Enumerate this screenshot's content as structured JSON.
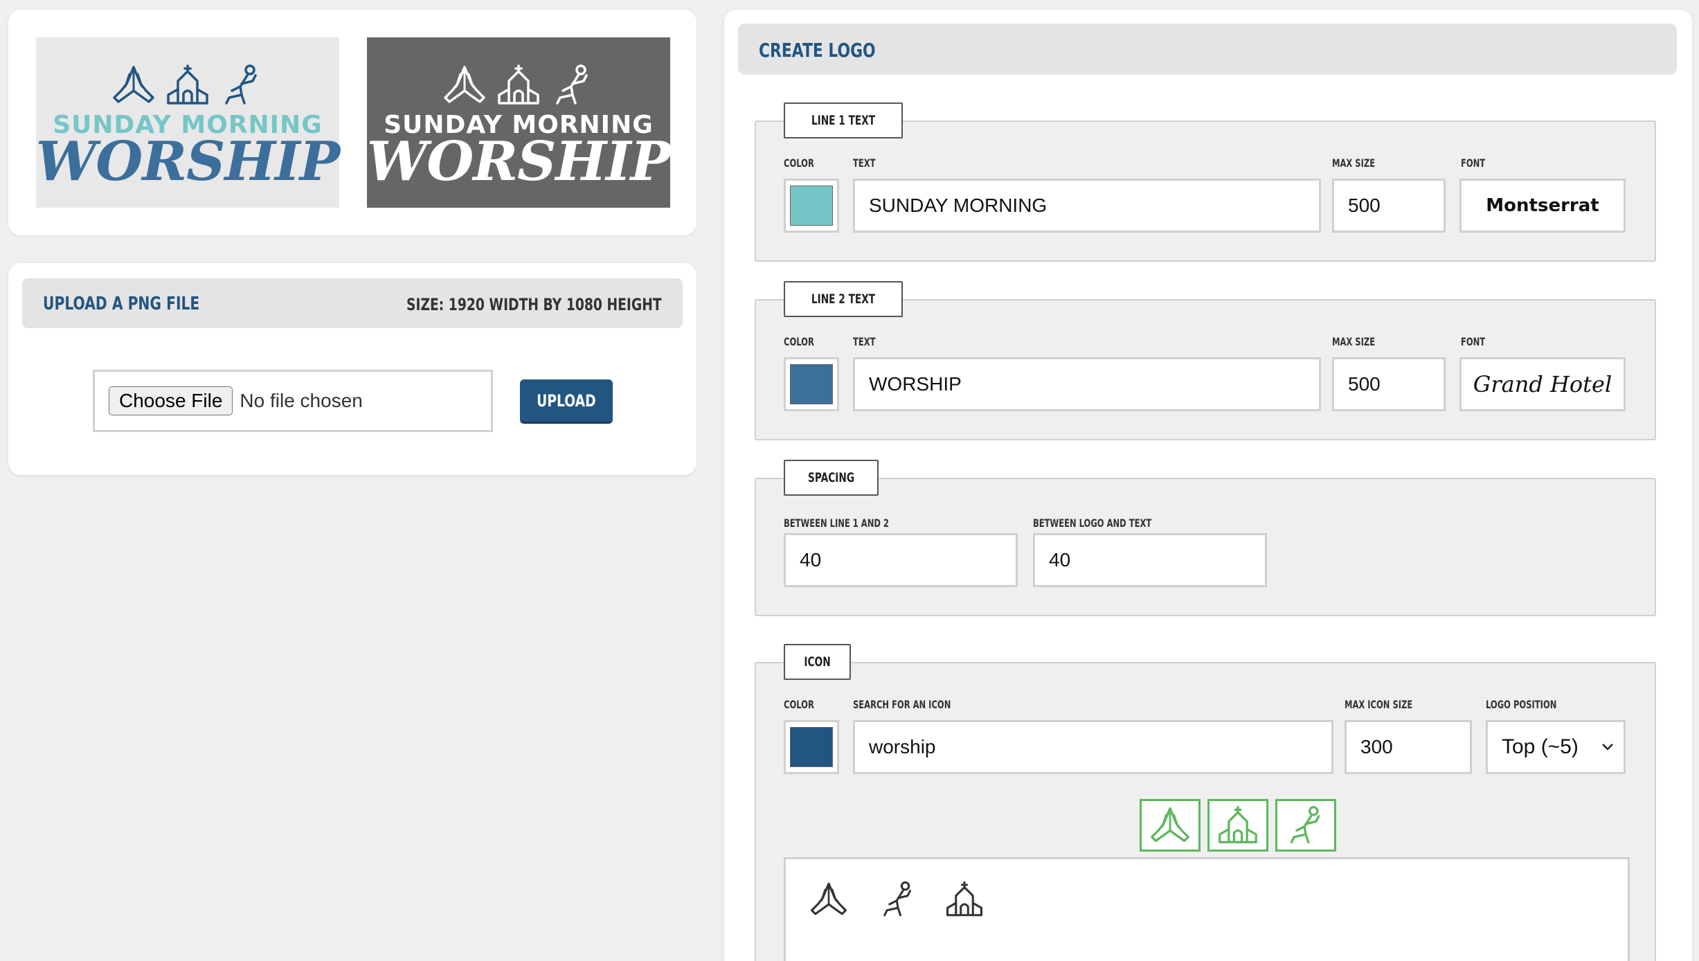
{
  "preview": {
    "line1": "SUNDAY MORNING",
    "line2": "WORSHIP"
  },
  "upload": {
    "title": "UPLOAD A PNG FILE",
    "size_note": "SIZE: 1920 WIDTH BY 1080 HEIGHT",
    "choose_label": "Choose File",
    "no_file": "No file chosen",
    "upload_label": "UPLOAD"
  },
  "create": {
    "title": "CREATE LOGO",
    "line1": {
      "legend": "LINE 1 TEXT",
      "color_label": "COLOR",
      "color": "#76c6c8",
      "text_label": "TEXT",
      "text": "SUNDAY MORNING",
      "max_label": "MAX SIZE",
      "max": "500",
      "font_label": "FONT",
      "font": "Montserrat"
    },
    "line2": {
      "legend": "LINE 2 TEXT",
      "color_label": "COLOR",
      "color": "#3c6f9b",
      "text_label": "TEXT",
      "text": "WORSHIP",
      "max_label": "MAX SIZE",
      "max": "500",
      "font_label": "FONT",
      "font": "Grand Hotel"
    },
    "spacing": {
      "legend": "SPACING",
      "between_lines_label": "BETWEEN LINE 1 AND 2",
      "between_lines": "40",
      "between_logo_label": "BETWEEN LOGO AND TEXT",
      "between_logo": "40"
    },
    "icon": {
      "legend": "ICON",
      "color_label": "COLOR",
      "color": "#225582",
      "search_label": "SEARCH FOR AN ICON",
      "search": "worship",
      "max_label": "MAX ICON SIZE",
      "max": "300",
      "position_label": "LOGO POSITION",
      "position": "Top (~5)",
      "selected_icons": [
        "praying-hands-icon",
        "church-icon",
        "kneeling-person-icon"
      ],
      "result_icons": [
        "praying-hands-icon",
        "kneeling-person-icon",
        "church-icon"
      ]
    }
  },
  "colors": {
    "accent": "#225582",
    "teal": "#76c6c8",
    "selected_border": "#5cb85c"
  }
}
